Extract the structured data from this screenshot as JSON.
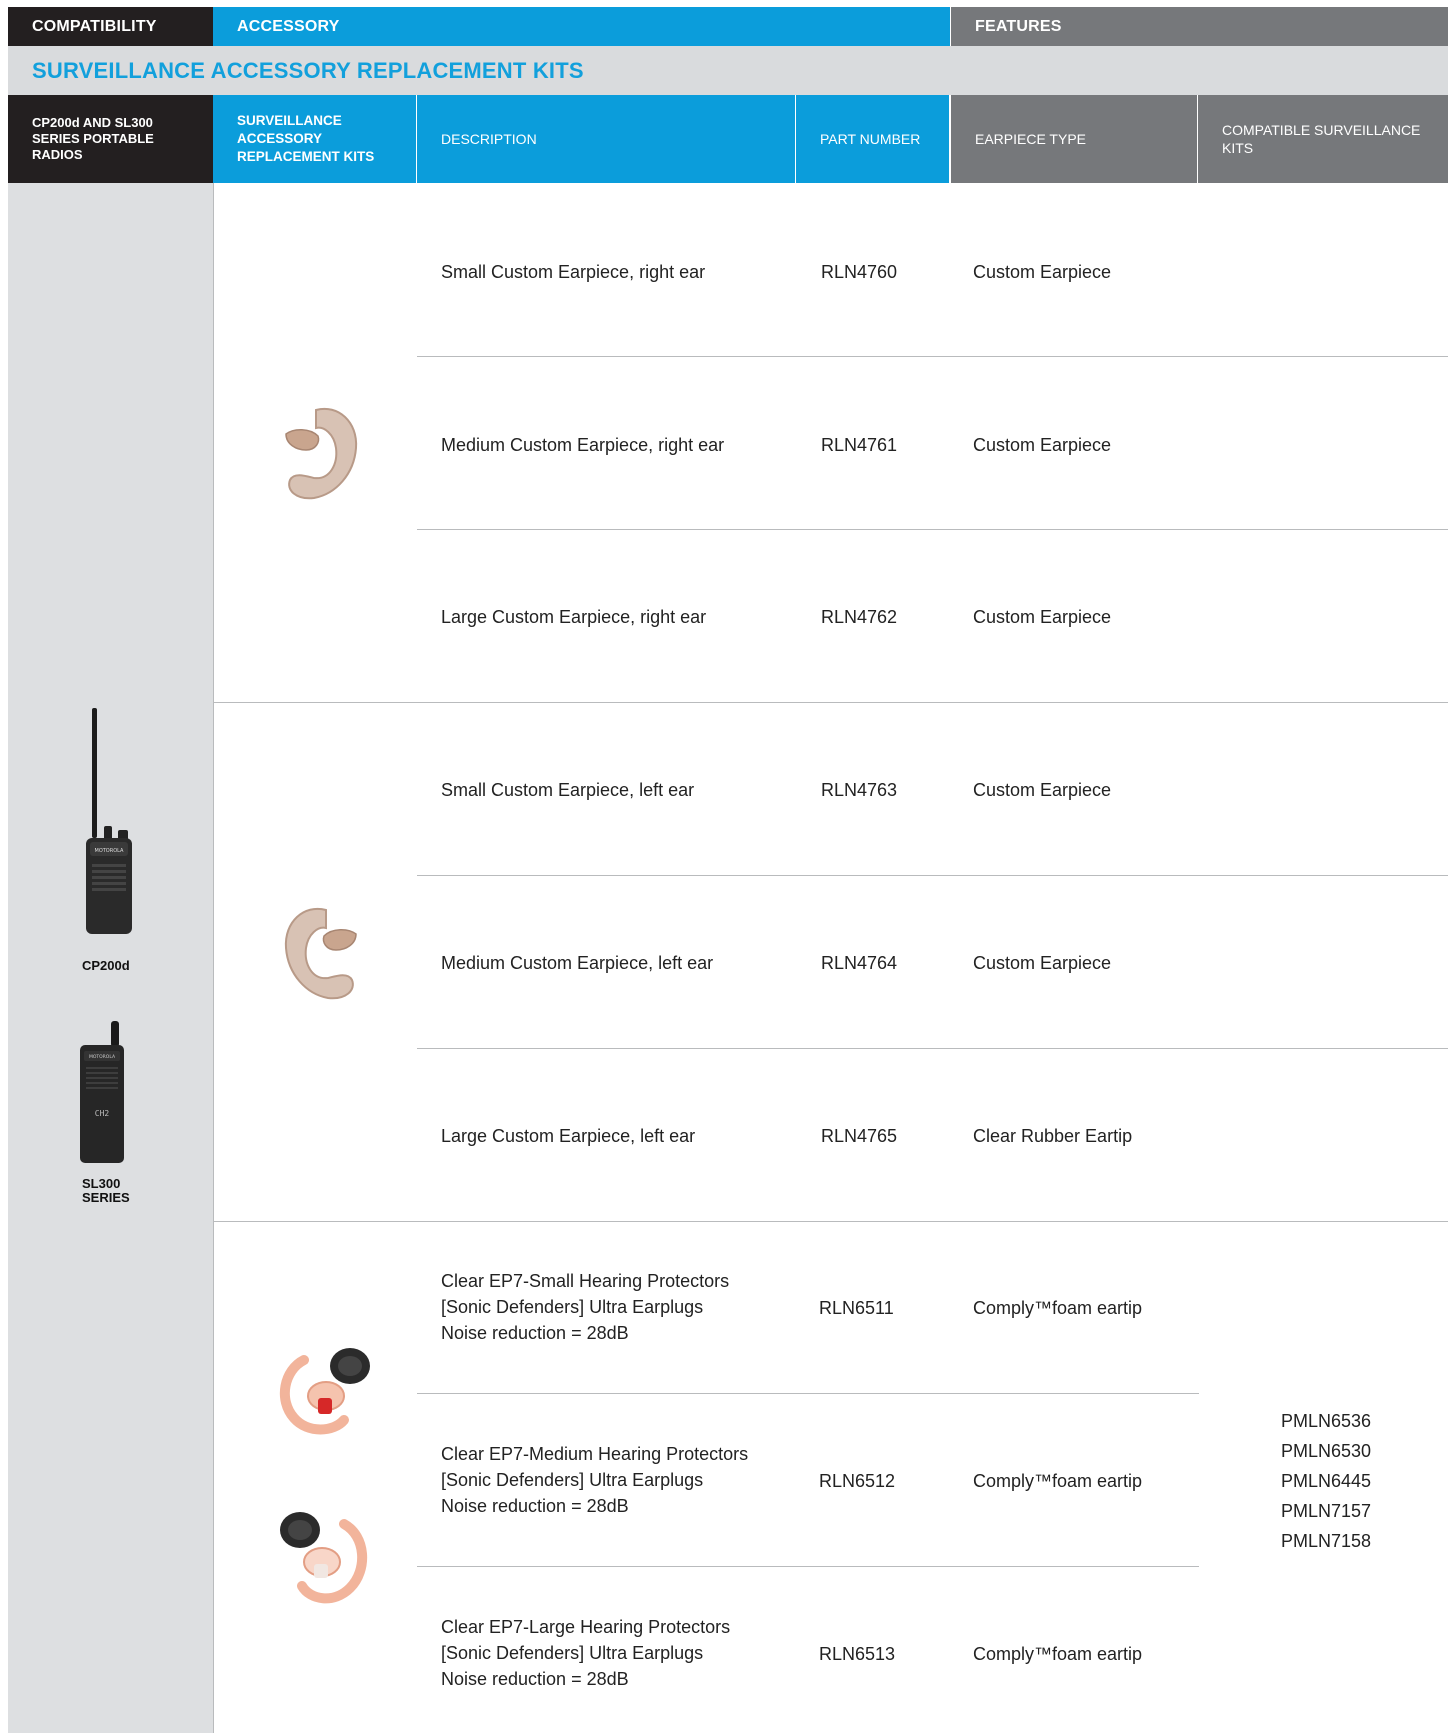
{
  "top_bands": {
    "compatibility": "COMPATIBILITY",
    "accessory": "ACCESSORY",
    "features": "FEATURES"
  },
  "section_title": "SURVEILLANCE ACCESSORY REPLACEMENT KITS",
  "column_headers": {
    "radios": "CP200d AND SL300 SERIES PORTABLE RADIOS",
    "kits": "SURVEILLANCE ACCESSORY REPLACEMENT KITS",
    "description": "DESCRIPTION",
    "part_number": "PART NUMBER",
    "earpiece_type": "EARPIECE TYPE",
    "compatible_kits": "COMPATIBLE SURVEILLANCE KITS"
  },
  "radios": {
    "cp200d": "CP200d",
    "sl300_line1": "SL300",
    "sl300_line2": "SERIES"
  },
  "rows": [
    {
      "description": [
        "Small Custom Earpiece, right ear"
      ],
      "part_number": "RLN4760",
      "earpiece_type": "Custom Earpiece"
    },
    {
      "description": [
        "Medium Custom Earpiece, right ear"
      ],
      "part_number": "RLN4761",
      "earpiece_type": "Custom Earpiece"
    },
    {
      "description": [
        "Large Custom Earpiece, right ear"
      ],
      "part_number": "RLN4762",
      "earpiece_type": "Custom Earpiece"
    },
    {
      "description": [
        "Small Custom Earpiece, left ear"
      ],
      "part_number": "RLN4763",
      "earpiece_type": "Custom Earpiece"
    },
    {
      "description": [
        "Medium Custom Earpiece, left ear"
      ],
      "part_number": "RLN4764",
      "earpiece_type": "Custom Earpiece"
    },
    {
      "description": [
        "Large Custom Earpiece, left ear"
      ],
      "part_number": "RLN4765",
      "earpiece_type": "Clear Rubber Eartip"
    },
    {
      "description": [
        "Clear EP7-Small Hearing Protectors",
        "[Sonic Defenders] Ultra Earplugs",
        "Noise reduction = 28dB"
      ],
      "part_number": "RLN6511",
      "earpiece_type": "Comply™foam eartip"
    },
    {
      "description": [
        "Clear EP7-Medium Hearing Protectors",
        "[Sonic Defenders] Ultra Earplugs",
        "Noise reduction = 28dB"
      ],
      "part_number": "RLN6512",
      "earpiece_type": "Comply™foam eartip"
    },
    {
      "description": [
        "Clear EP7-Large Hearing Protectors",
        "[Sonic Defenders] Ultra Earplugs",
        "Noise reduction = 28dB"
      ],
      "part_number": "RLN6513",
      "earpiece_type": "Comply™foam eartip"
    }
  ],
  "compatible_kits": [
    "PMLN6536",
    "PMLN6530",
    "PMLN6445",
    "PMLN7157",
    "PMLN7158"
  ],
  "colors": {
    "black": "#231f20",
    "blue": "#0b9ddb",
    "gray": "#76787b",
    "title_blue": "#12a0dc",
    "panel_gray": "#dddfe1"
  }
}
